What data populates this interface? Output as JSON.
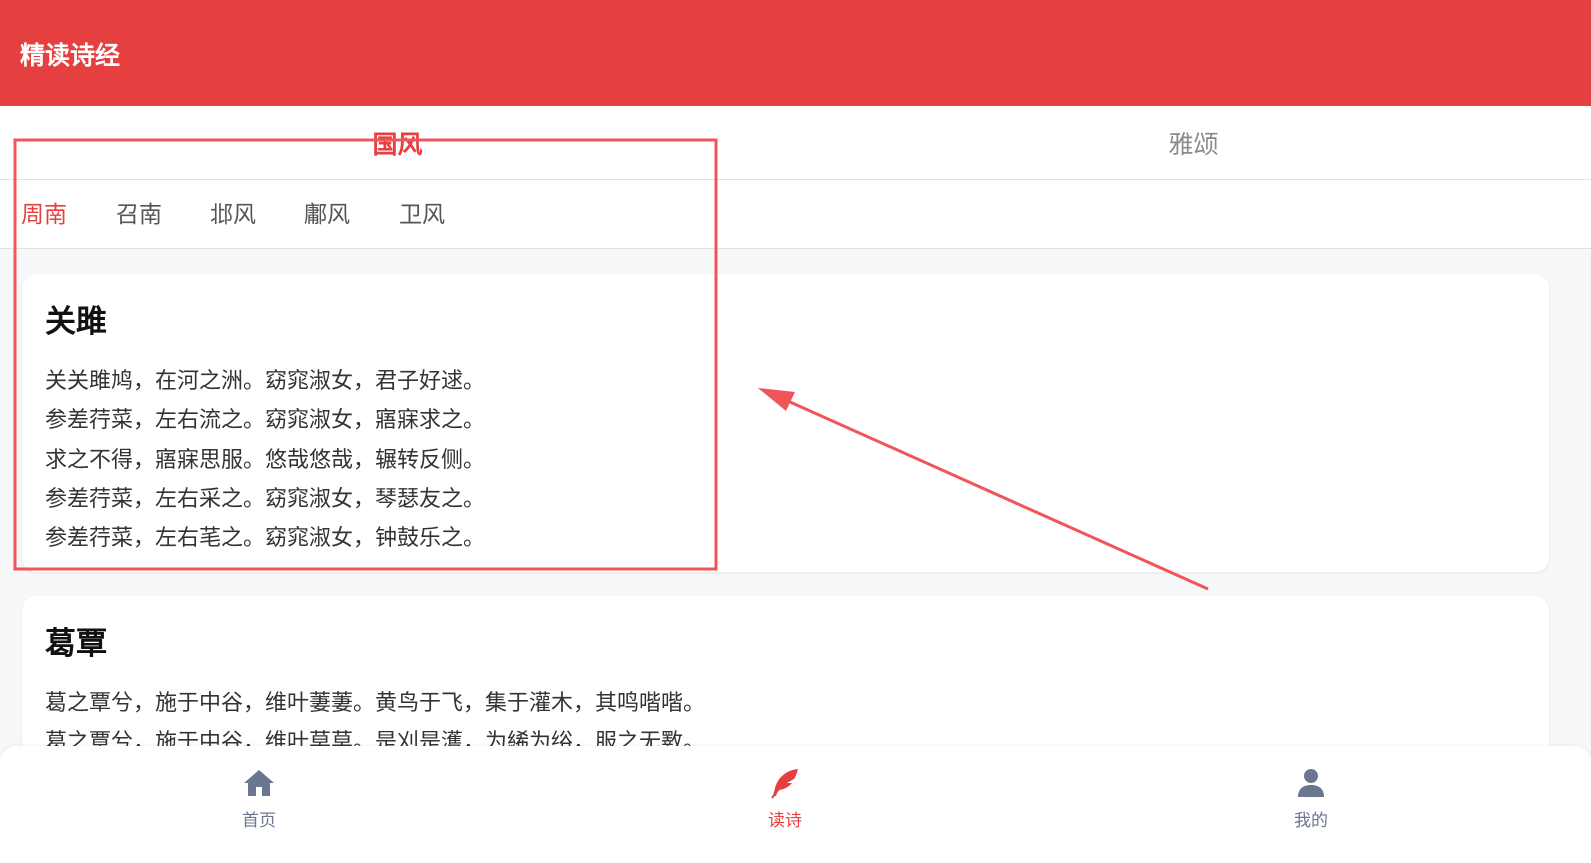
{
  "appbar": {
    "title": "精读诗经"
  },
  "tabs": [
    {
      "label": "国风",
      "active": true
    },
    {
      "label": "雅颂",
      "active": false
    }
  ],
  "subtabs": [
    {
      "label": "周南",
      "active": true
    },
    {
      "label": "召南",
      "active": false
    },
    {
      "label": "邶风",
      "active": false
    },
    {
      "label": "鄘风",
      "active": false
    },
    {
      "label": "卫风",
      "active": false
    }
  ],
  "poems": [
    {
      "title": "关雎",
      "lines": [
        "关关雎鸠，在河之洲。窈窕淑女，君子好逑。",
        "参差荇菜，左右流之。窈窕淑女，寤寐求之。",
        "求之不得，寤寐思服。悠哉悠哉，辗转反侧。",
        "参差荇菜，左右采之。窈窕淑女，琴瑟友之。",
        "参差荇菜，左右芼之。窈窕淑女，钟鼓乐之。"
      ]
    },
    {
      "title": "葛覃",
      "lines": [
        "葛之覃兮，施于中谷，维叶萋萋。黄鸟于飞，集于灌木，其鸣喈喈。",
        "葛之覃兮，施于中谷，维叶莫莫。是刈是濩，为絺为绤，服之无斁。"
      ]
    }
  ],
  "bottom_nav": [
    {
      "label": "首页",
      "icon": "home-icon",
      "active": false
    },
    {
      "label": "读诗",
      "icon": "feather-icon",
      "active": true
    },
    {
      "label": "我的",
      "icon": "user-icon",
      "active": false
    }
  ],
  "colors": {
    "accent": "#e53f40",
    "annotation": "#f0555a",
    "nav_inactive": "#6b7790"
  }
}
